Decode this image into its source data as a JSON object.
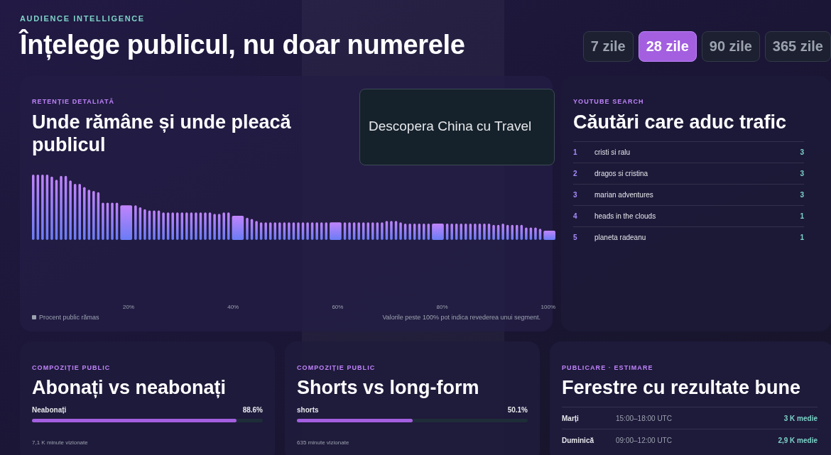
{
  "header": {
    "eyebrow": "AUDIENCE INTELLIGENCE",
    "title": "Înțelege publicul, nu doar numerele"
  },
  "ranges": [
    {
      "label": "7 zile",
      "selected": false
    },
    {
      "label": "28 zile",
      "selected": true
    },
    {
      "label": "90 zile",
      "selected": false
    },
    {
      "label": "365 zile",
      "selected": false
    }
  ],
  "retention": {
    "eyebrow": "RETENȚIE DETALIATĂ",
    "title": "Unde rămâne și unde pleacă publicul",
    "overlay_caption": "Descopera China cu Travel",
    "x_labels": [
      "20%",
      "40%",
      "60%",
      "80%",
      "100%"
    ],
    "legend": "Procent public rămas",
    "note": "Valorile peste 100% pot indica revederea unui segment."
  },
  "search": {
    "eyebrow": "YOUTUBE SEARCH",
    "title": "Căutări care aduc trafic",
    "rows": [
      {
        "rank": "1",
        "query": "cristi si ralu",
        "count": "3"
      },
      {
        "rank": "2",
        "query": "dragos si cristina",
        "count": "3"
      },
      {
        "rank": "3",
        "query": "marian adventures",
        "count": "3"
      },
      {
        "rank": "4",
        "query": "heads in the clouds",
        "count": "1"
      },
      {
        "rank": "5",
        "query": "planeta radeanu",
        "count": "1"
      }
    ]
  },
  "cards": [
    {
      "kind": "split",
      "eyebrow": "COMPOZIȚIE PUBLIC",
      "title": "Abonați vs neabonați",
      "label": "Neabonați",
      "value": "88.6%",
      "level": 0.886,
      "footnote": "7,1 K minute vizionate"
    },
    {
      "kind": "split",
      "eyebrow": "COMPOZIȚIE PUBLIC",
      "title": "Shorts vs long-form",
      "label": "shorts",
      "value": "50.1%",
      "level": 0.501,
      "footnote": "635 minute vizionate"
    },
    {
      "kind": "windows",
      "eyebrow": "PUBLICARE · ESTIMARE",
      "title": "Ferestre cu rezultate bune",
      "rows": [
        {
          "day": "Marți",
          "time": "15:00–18:00 UTC",
          "value": "3 K medie"
        },
        {
          "day": "Duminică",
          "time": "09:00–12:00 UTC",
          "value": "2,9 K medie"
        }
      ]
    }
  ]
}
